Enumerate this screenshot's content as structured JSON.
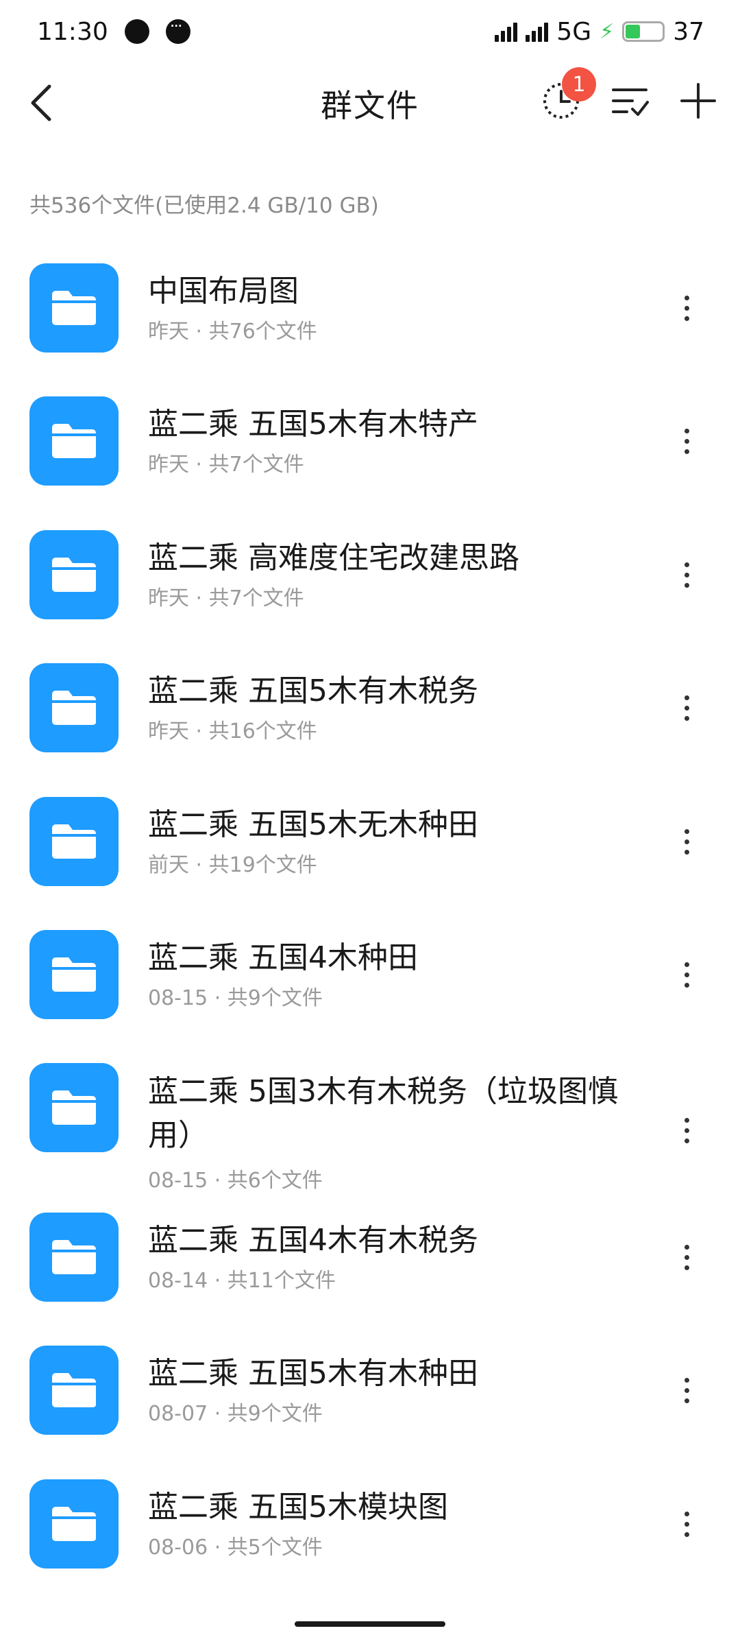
{
  "status_bar": {
    "time": "11:30",
    "network": "5G",
    "battery": "37",
    "battery_level_percent": 37
  },
  "header": {
    "title": "群文件",
    "badge_count": "1",
    "icons": {
      "back": "back-chevron-icon",
      "history": "history-clock-icon",
      "sort": "sort-list-icon",
      "add": "plus-icon"
    }
  },
  "summary": "共536个文件(已使用2.4 GB/10 GB)",
  "files": [
    {
      "name": "中国布局图",
      "meta": "昨天 · 共76个文件"
    },
    {
      "name": "蓝二乘 五国5木有木特产",
      "meta": "昨天 · 共7个文件"
    },
    {
      "name": "蓝二乘 高难度住宅改建思路",
      "meta": "昨天 · 共7个文件"
    },
    {
      "name": "蓝二乘 五国5木有木税务",
      "meta": "昨天 · 共16个文件"
    },
    {
      "name": "蓝二乘 五国5木无木种田",
      "meta": "前天 · 共19个文件"
    },
    {
      "name": "蓝二乘 五国4木种田",
      "meta": "08-15 · 共9个文件"
    },
    {
      "name": "蓝二乘 5国3木有木税务（垃圾图慎用）",
      "meta": "08-15 · 共6个文件"
    },
    {
      "name": "蓝二乘 五国4木有木税务",
      "meta": "08-14 · 共11个文件"
    },
    {
      "name": "蓝二乘 五国5木有木种田",
      "meta": "08-07 · 共9个文件"
    },
    {
      "name": "蓝二乘 五国5木模块图",
      "meta": "08-06 · 共5个文件"
    }
  ],
  "colors": {
    "folder": "#1e9cff",
    "badge": "#f25342",
    "secondary_text": "#9a9a9a"
  }
}
